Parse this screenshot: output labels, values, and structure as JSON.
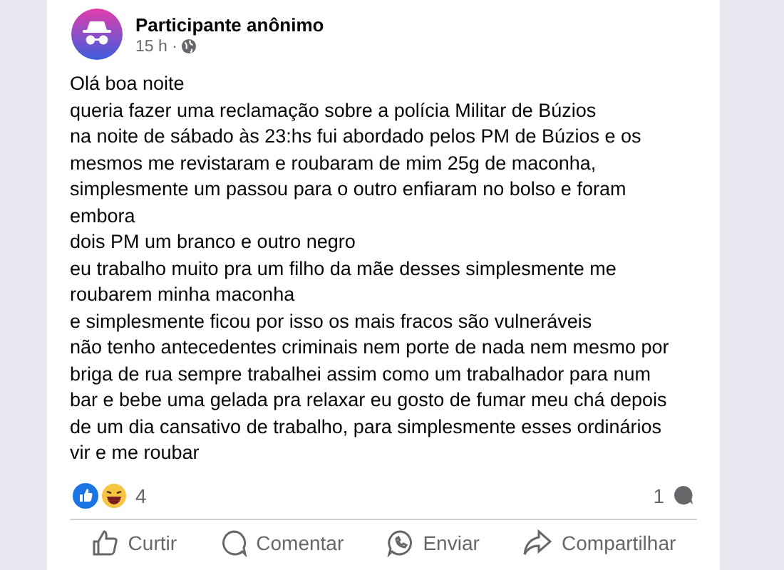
{
  "post": {
    "author": "Participante anônimo",
    "time": "15 h ·",
    "lines": [
      "Olá boa noite",
      "queria fazer uma reclamação sobre a polícia Militar de Búzios",
      "na noite de sábado às 23:hs fui abordado pelos PM de Búzios e os",
      "mesmos me revistaram e roubaram de mim 25g de maconha,",
      "simplesmente um passou para o outro enfiaram no bolso e foram",
      "embora",
      "dois PM um branco e outro negro",
      "eu trabalho muito pra um filho da mãe desses simplesmente me",
      "roubarem minha maconha",
      "e simplesmente ficou por isso os mais fracos são vulneráveis",
      "não tenho antecedentes criminais nem porte de nada nem mesmo por",
      "briga de rua sempre trabalhei assim como um trabalhador para num",
      "bar e bebe uma gelada pra relaxar eu gosto de fumar meu chá depois",
      "de um dia cansativo de trabalho, para simplesmente esses ordinários",
      "vir e me roubar"
    ],
    "reaction_count": "4",
    "comment_count": "1",
    "actions": [
      {
        "kind": "like",
        "label": "Curtir"
      },
      {
        "kind": "comment",
        "label": "Comentar"
      },
      {
        "kind": "send",
        "label": "Enviar"
      },
      {
        "kind": "share",
        "label": "Compartilhar"
      }
    ]
  }
}
